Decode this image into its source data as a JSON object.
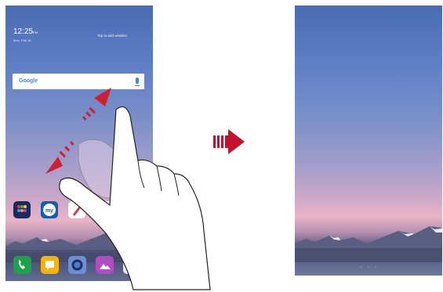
{
  "left_screen": {
    "clock": "12:25",
    "clock_suffix": "PM",
    "date": "Mon, Feb 16",
    "weather_hint": "Tap to add weather",
    "search_logo": "Google",
    "apps": [
      "app-folder-icon",
      "my-app-icon",
      "pen-app-icon",
      "app-icon"
    ],
    "dock": [
      "phone-icon",
      "messages-icon",
      "camera-icon",
      "gallery-icon"
    ]
  },
  "arrow": {
    "direction": "right"
  },
  "right_screen": {
    "pager": "• ⌂ •"
  },
  "colors": {
    "arrow_red": "#c8102e",
    "gesture_arrow_red": "#d21f2f"
  }
}
